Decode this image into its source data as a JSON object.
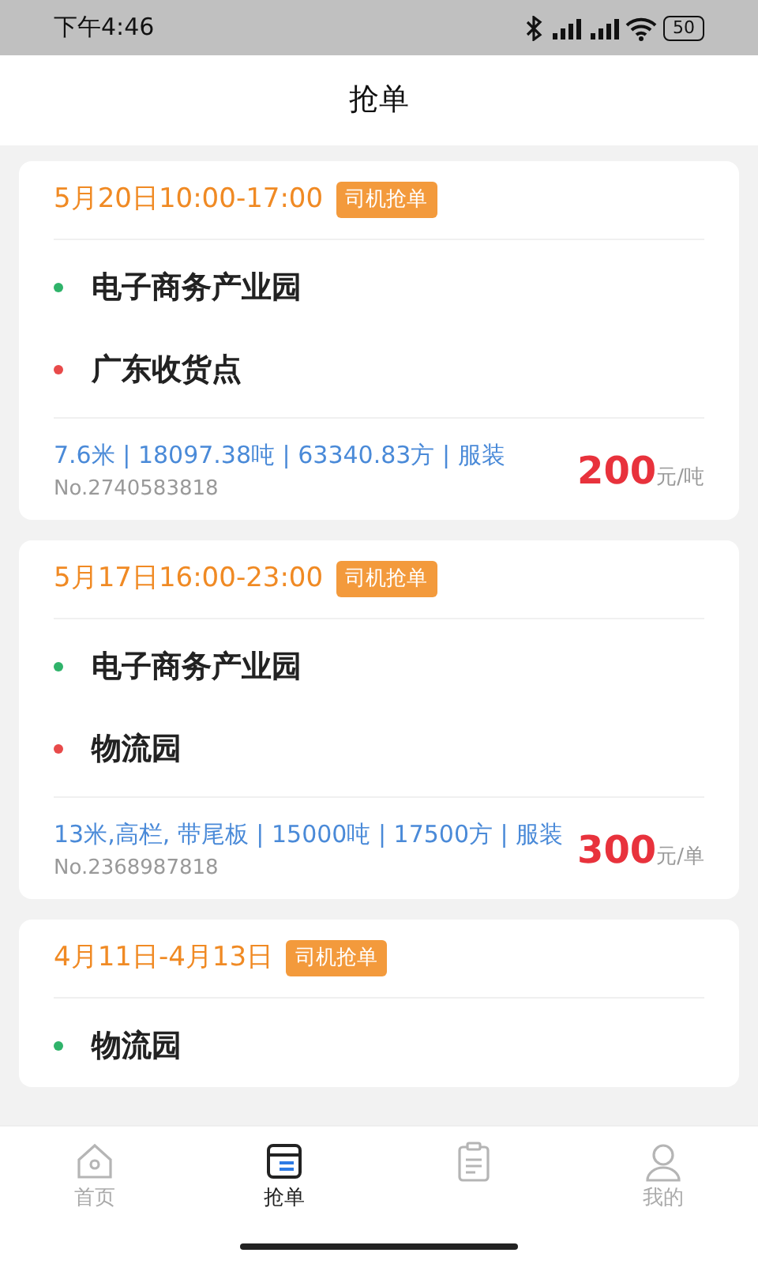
{
  "status_bar": {
    "time": "下午4:46",
    "battery": "50"
  },
  "header": {
    "title": "抢单"
  },
  "orders": [
    {
      "date": "5月20日10:00-17:00",
      "tag": "司机抢单",
      "stops": [
        {
          "name": "电子商务产业园",
          "color": "#2fb36a"
        },
        {
          "name": "广东收货点",
          "color": "#e84a4a"
        }
      ],
      "details": "7.6米 | 18097.38吨 | 63340.83方 | 服装",
      "number": "No.2740583818",
      "price": "200",
      "unit": "元/吨"
    },
    {
      "date": "5月17日16:00-23:00",
      "tag": "司机抢单",
      "stops": [
        {
          "name": "电子商务产业园",
          "color": "#2fb36a"
        },
        {
          "name": "物流园",
          "color": "#e84a4a"
        }
      ],
      "details": "13米,高栏, 带尾板 | 15000吨 | 17500方 | 服装",
      "number": "No.2368987818",
      "price": "300",
      "unit": "元/单"
    },
    {
      "date": "4月11日-4月13日",
      "tag": "司机抢单",
      "stops": [
        {
          "name": "物流园",
          "color": "#2fb36a"
        }
      ]
    }
  ],
  "tabs": [
    {
      "kind": "home",
      "label": "首页",
      "selected": false
    },
    {
      "kind": "grab",
      "label": "抢单",
      "selected": true
    },
    {
      "kind": "orders",
      "selected": false
    },
    {
      "kind": "profile",
      "label": "我的",
      "selected": false
    }
  ]
}
